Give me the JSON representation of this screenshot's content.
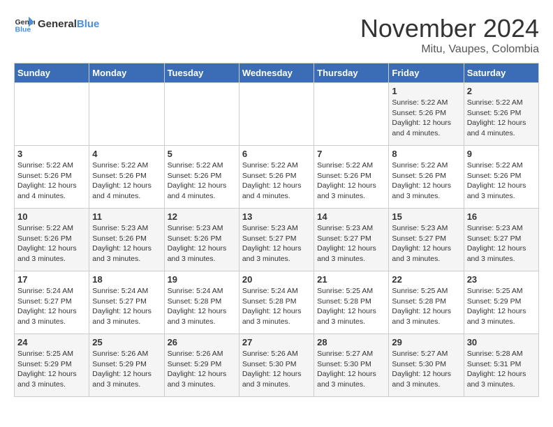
{
  "logo": {
    "text_general": "General",
    "text_blue": "Blue"
  },
  "title": "November 2024",
  "location": "Mitu, Vaupes, Colombia",
  "days_of_week": [
    "Sunday",
    "Monday",
    "Tuesday",
    "Wednesday",
    "Thursday",
    "Friday",
    "Saturday"
  ],
  "weeks": [
    [
      {
        "day": "",
        "info": ""
      },
      {
        "day": "",
        "info": ""
      },
      {
        "day": "",
        "info": ""
      },
      {
        "day": "",
        "info": ""
      },
      {
        "day": "",
        "info": ""
      },
      {
        "day": "1",
        "info": "Sunrise: 5:22 AM\nSunset: 5:26 PM\nDaylight: 12 hours and 4 minutes."
      },
      {
        "day": "2",
        "info": "Sunrise: 5:22 AM\nSunset: 5:26 PM\nDaylight: 12 hours and 4 minutes."
      }
    ],
    [
      {
        "day": "3",
        "info": "Sunrise: 5:22 AM\nSunset: 5:26 PM\nDaylight: 12 hours and 4 minutes."
      },
      {
        "day": "4",
        "info": "Sunrise: 5:22 AM\nSunset: 5:26 PM\nDaylight: 12 hours and 4 minutes."
      },
      {
        "day": "5",
        "info": "Sunrise: 5:22 AM\nSunset: 5:26 PM\nDaylight: 12 hours and 4 minutes."
      },
      {
        "day": "6",
        "info": "Sunrise: 5:22 AM\nSunset: 5:26 PM\nDaylight: 12 hours and 4 minutes."
      },
      {
        "day": "7",
        "info": "Sunrise: 5:22 AM\nSunset: 5:26 PM\nDaylight: 12 hours and 3 minutes."
      },
      {
        "day": "8",
        "info": "Sunrise: 5:22 AM\nSunset: 5:26 PM\nDaylight: 12 hours and 3 minutes."
      },
      {
        "day": "9",
        "info": "Sunrise: 5:22 AM\nSunset: 5:26 PM\nDaylight: 12 hours and 3 minutes."
      }
    ],
    [
      {
        "day": "10",
        "info": "Sunrise: 5:22 AM\nSunset: 5:26 PM\nDaylight: 12 hours and 3 minutes."
      },
      {
        "day": "11",
        "info": "Sunrise: 5:23 AM\nSunset: 5:26 PM\nDaylight: 12 hours and 3 minutes."
      },
      {
        "day": "12",
        "info": "Sunrise: 5:23 AM\nSunset: 5:26 PM\nDaylight: 12 hours and 3 minutes."
      },
      {
        "day": "13",
        "info": "Sunrise: 5:23 AM\nSunset: 5:27 PM\nDaylight: 12 hours and 3 minutes."
      },
      {
        "day": "14",
        "info": "Sunrise: 5:23 AM\nSunset: 5:27 PM\nDaylight: 12 hours and 3 minutes."
      },
      {
        "day": "15",
        "info": "Sunrise: 5:23 AM\nSunset: 5:27 PM\nDaylight: 12 hours and 3 minutes."
      },
      {
        "day": "16",
        "info": "Sunrise: 5:23 AM\nSunset: 5:27 PM\nDaylight: 12 hours and 3 minutes."
      }
    ],
    [
      {
        "day": "17",
        "info": "Sunrise: 5:24 AM\nSunset: 5:27 PM\nDaylight: 12 hours and 3 minutes."
      },
      {
        "day": "18",
        "info": "Sunrise: 5:24 AM\nSunset: 5:27 PM\nDaylight: 12 hours and 3 minutes."
      },
      {
        "day": "19",
        "info": "Sunrise: 5:24 AM\nSunset: 5:28 PM\nDaylight: 12 hours and 3 minutes."
      },
      {
        "day": "20",
        "info": "Sunrise: 5:24 AM\nSunset: 5:28 PM\nDaylight: 12 hours and 3 minutes."
      },
      {
        "day": "21",
        "info": "Sunrise: 5:25 AM\nSunset: 5:28 PM\nDaylight: 12 hours and 3 minutes."
      },
      {
        "day": "22",
        "info": "Sunrise: 5:25 AM\nSunset: 5:28 PM\nDaylight: 12 hours and 3 minutes."
      },
      {
        "day": "23",
        "info": "Sunrise: 5:25 AM\nSunset: 5:29 PM\nDaylight: 12 hours and 3 minutes."
      }
    ],
    [
      {
        "day": "24",
        "info": "Sunrise: 5:25 AM\nSunset: 5:29 PM\nDaylight: 12 hours and 3 minutes."
      },
      {
        "day": "25",
        "info": "Sunrise: 5:26 AM\nSunset: 5:29 PM\nDaylight: 12 hours and 3 minutes."
      },
      {
        "day": "26",
        "info": "Sunrise: 5:26 AM\nSunset: 5:29 PM\nDaylight: 12 hours and 3 minutes."
      },
      {
        "day": "27",
        "info": "Sunrise: 5:26 AM\nSunset: 5:30 PM\nDaylight: 12 hours and 3 minutes."
      },
      {
        "day": "28",
        "info": "Sunrise: 5:27 AM\nSunset: 5:30 PM\nDaylight: 12 hours and 3 minutes."
      },
      {
        "day": "29",
        "info": "Sunrise: 5:27 AM\nSunset: 5:30 PM\nDaylight: 12 hours and 3 minutes."
      },
      {
        "day": "30",
        "info": "Sunrise: 5:28 AM\nSunset: 5:31 PM\nDaylight: 12 hours and 3 minutes."
      }
    ]
  ]
}
